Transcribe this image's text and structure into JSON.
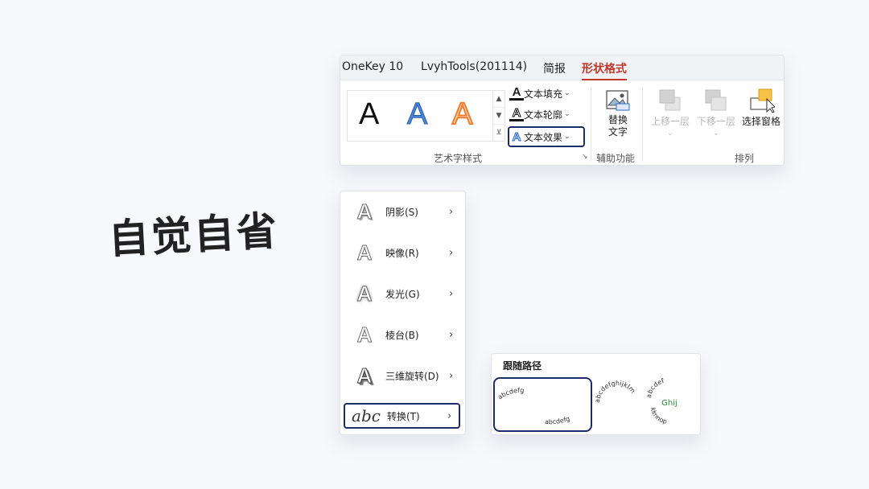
{
  "heading": "自觉自省",
  "ribbon": {
    "tabs": [
      "OneKey 10",
      "LvyhTools(201114)",
      "简报",
      "形状格式"
    ],
    "active_tab": "形状格式",
    "gallery": {
      "samples": [
        {
          "glyph": "A",
          "style": "black-fill"
        },
        {
          "glyph": "A",
          "style": "blue-gradient"
        },
        {
          "glyph": "A",
          "style": "orange-outline"
        }
      ],
      "scroll_up": "▲",
      "scroll_down": "▼",
      "more": "⊻"
    },
    "text_fill": "文本填充",
    "text_outline": "文本轮廓",
    "text_effects": "文本效果",
    "chevron": "⌄",
    "wordart_group": "艺术字样式",
    "alt_text_line1": "替换",
    "alt_text_line2": "文字",
    "accessibility_group": "辅助功能",
    "bring_forward": "上移一层",
    "send_backward": "下移一层",
    "selection_pane": "选择窗格",
    "arrange_group": "排列",
    "launcher": "↘",
    "accent_color": "#c0392b",
    "highlight_color": "#1f2a6b"
  },
  "effects_menu": {
    "items": [
      {
        "label": "阴影(S)",
        "icon": "shadow-a-icon"
      },
      {
        "label": "映像(R)",
        "icon": "reflection-a-icon"
      },
      {
        "label": "发光(G)",
        "icon": "glow-a-icon"
      },
      {
        "label": "棱台(B)",
        "icon": "bevel-a-icon"
      },
      {
        "label": "三维旋转(D)",
        "icon": "3d-rotation-a-icon"
      },
      {
        "label": "转换(T)",
        "icon": "abc-transform-icon"
      }
    ],
    "icon_glyph": "A",
    "transform_glyph": "abc",
    "arrow": "›"
  },
  "follow_path": {
    "title": "跟随路径",
    "options": [
      {
        "name": "arch-wave",
        "text1": "abcdefg",
        "text2": "abcdefg"
      },
      {
        "name": "circle",
        "text": "abcdefghijklm"
      },
      {
        "name": "button",
        "outer": "abcdef",
        "middle": "Ghij",
        "inner": "klmnop"
      }
    ]
  }
}
